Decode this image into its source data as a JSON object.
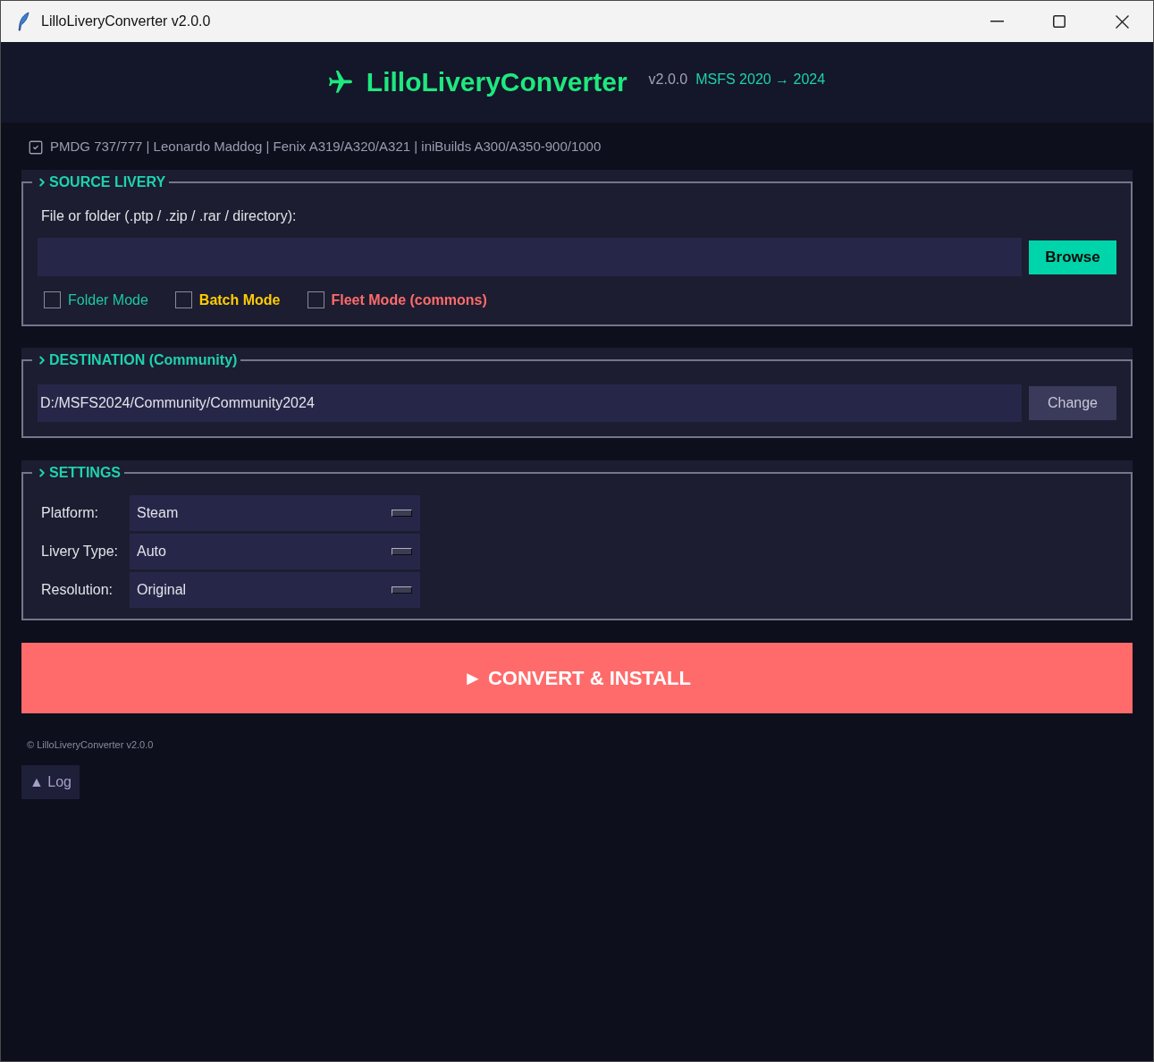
{
  "window": {
    "title": "LilloLiveryConverter v2.0.0"
  },
  "header": {
    "title": "LilloLiveryConverter",
    "version": "v2.0.0",
    "subtitle": "MSFS 2020 → 2024"
  },
  "supported_aircraft": "PMDG 737/777 | Leonardo Maddog | Fenix A319/A320/A321 | iniBuilds A300/A350-900/1000",
  "source": {
    "heading": "SOURCE LIVERY",
    "label": "File or folder (.ptp / .zip / .rar / directory):",
    "button": "Browse",
    "options": [
      {
        "label": "Folder Mode",
        "checked": false,
        "bold": false,
        "color": "#1cc9a4"
      },
      {
        "label": "Batch Mode",
        "checked": false,
        "bold": true,
        "color": "#ffcc00"
      },
      {
        "label": "Fleet Mode (commons)",
        "checked": false,
        "bold": true,
        "color": "#ff6b6b"
      }
    ]
  },
  "destination": {
    "heading": "DESTINATION (Community)",
    "path": "D:/MSFS2024/Community/Community2024",
    "button": "Change"
  },
  "settings": {
    "heading": "SETTINGS",
    "rows": [
      {
        "label": "Platform:",
        "value": "Steam"
      },
      {
        "label": "Livery Type:",
        "value": "Auto"
      },
      {
        "label": "Resolution:",
        "value": "Original"
      }
    ]
  },
  "convert_button": "► CONVERT & INSTALL",
  "footer": "© LilloLiveryConverter v2.0.0",
  "log_button": "▲ Log"
}
